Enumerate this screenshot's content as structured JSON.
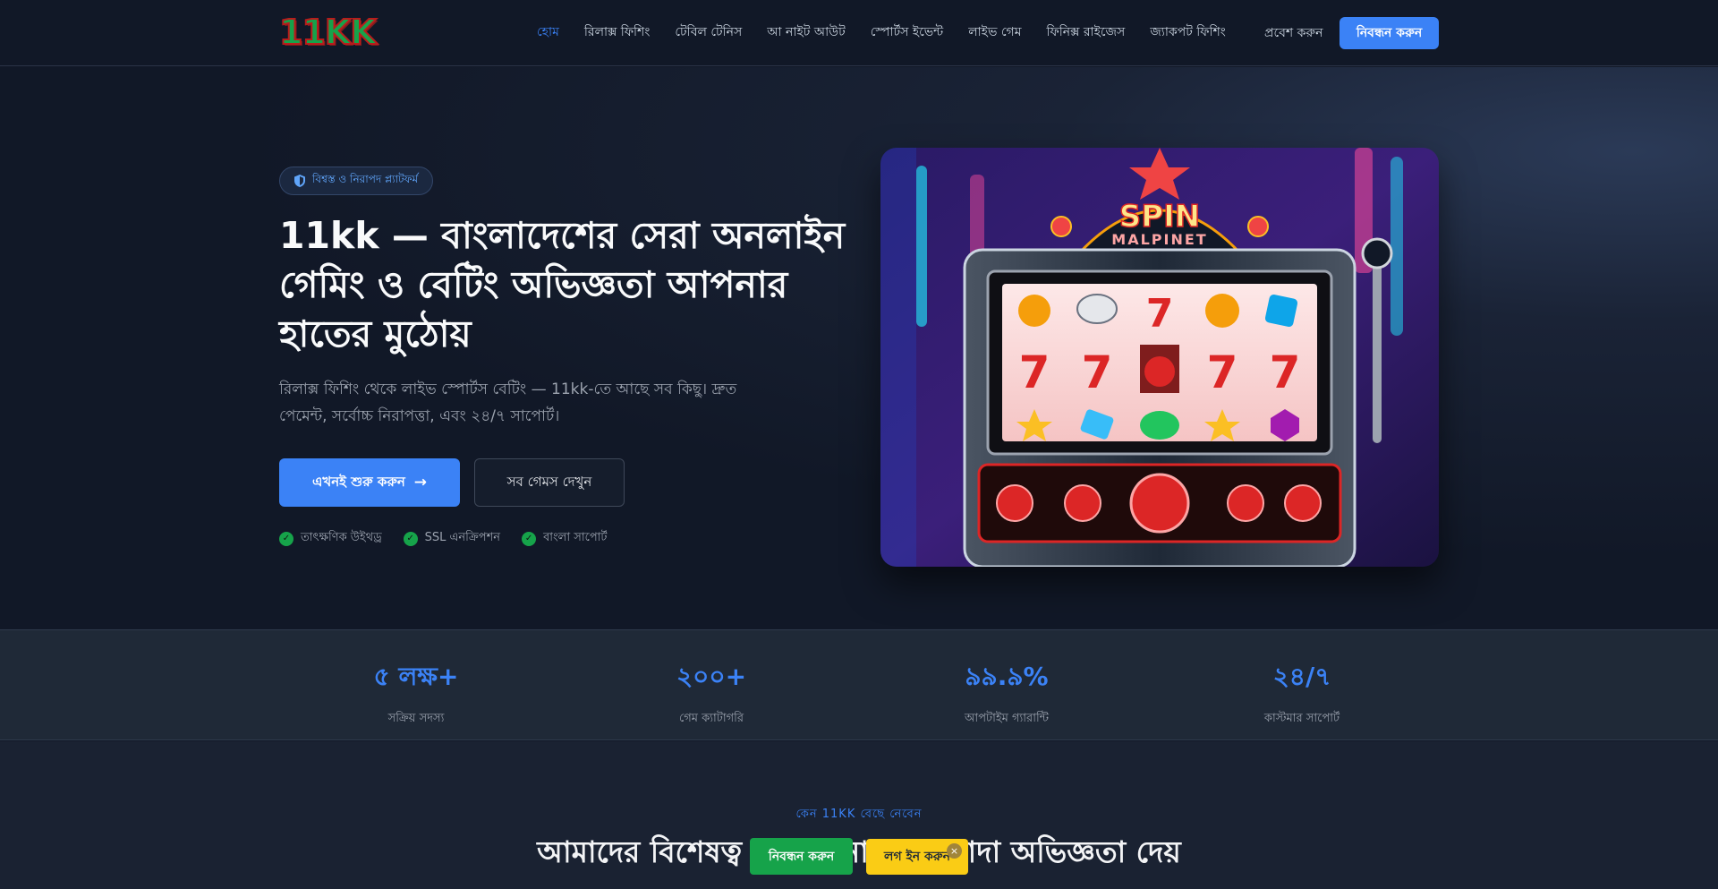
{
  "header": {
    "logo": "11KK",
    "nav": [
      {
        "label": "হোম",
        "active": true
      },
      {
        "label": "রিলাক্স ফিশিং",
        "active": false
      },
      {
        "label": "টেবিল টেনিস",
        "active": false
      },
      {
        "label": "আ নাইট আউট",
        "active": false
      },
      {
        "label": "স্পোর্টস ইভেন্ট",
        "active": false
      },
      {
        "label": "লাইভ গেম",
        "active": false
      },
      {
        "label": "ফিনিক্স রাইজেস",
        "active": false
      },
      {
        "label": "জ্যাকপট ফিশিং",
        "active": false
      }
    ],
    "login_label": "প্রবেশ করুন",
    "register_label": "নিবন্ধন করুন"
  },
  "hero": {
    "badge": "বিশ্বস্ত ও নিরাপদ প্ল্যাটফর্ম",
    "title": "11kk — বাংলাদেশের সেরা অনলাইন গেমিং ও বেটিং অভিজ্ঞতা আপনার হাতের মুঠোয়",
    "subtitle": "রিলাক্স ফিশিং থেকে লাইভ স্পোর্টস বেটিং — 11kk-তে আছে সব কিছু। দ্রুত পেমেন্ট, সর্বোচ্চ নিরাপত্তা, এবং ২৪/৭ সাপোর্ট।",
    "cta_primary": "এখনই শুরু করুন",
    "cta_secondary": "সব গেমস দেখুন",
    "features": [
      "তাৎক্ষণিক উইথড্র",
      "SSL এনক্রিপশন",
      "বাংলা সাপোর্ট"
    ],
    "image": {
      "sign_top": "SPIN",
      "sign_bottom": "MALPINET"
    }
  },
  "stats": [
    {
      "value": "৫ লক্ষ+",
      "label": "সক্রিয় সদস্য"
    },
    {
      "value": "২০০+",
      "label": "গেম ক্যাটাগরি"
    },
    {
      "value": "৯৯.৯%",
      "label": "আপটাইম গ্যারান্টি"
    },
    {
      "value": "২৪/৭",
      "label": "কাস্টমার সাপোর্ট"
    }
  ],
  "why": {
    "eyebrow": "কেন 11KK বেছে নেবেন",
    "title": "আমাদের বিশেষত্ব যা আপনাকে আলাদা অভিজ্ঞতা দেয়"
  },
  "floating": {
    "register_label": "নিবন্ধন করুন",
    "login_label": "লগ ইন করুন",
    "close_icon": "×"
  },
  "colors": {
    "accent": "#3b82f6",
    "success": "#16a34a",
    "warning": "#facc15",
    "background": "#111827"
  }
}
